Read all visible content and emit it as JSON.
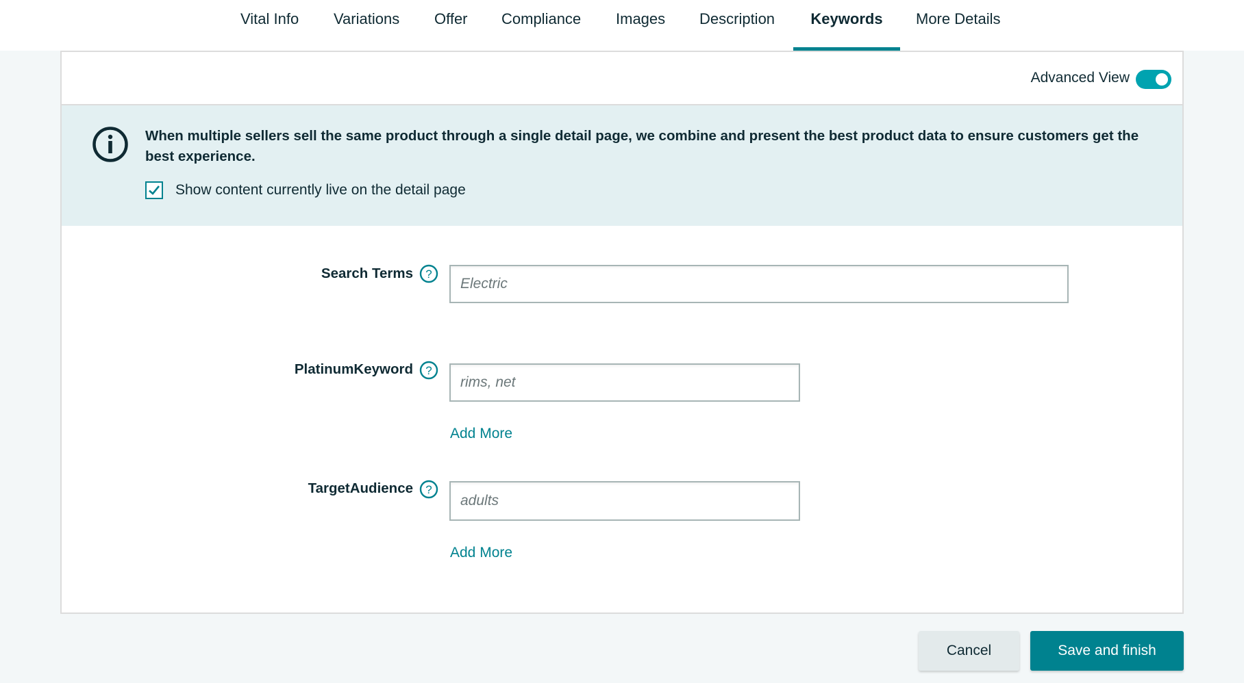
{
  "tabs": [
    {
      "label": "Vital Info",
      "active": false
    },
    {
      "label": "Variations",
      "active": false
    },
    {
      "label": "Offer",
      "active": false
    },
    {
      "label": "Compliance",
      "active": false
    },
    {
      "label": "Images",
      "active": false
    },
    {
      "label": "Description",
      "active": false
    },
    {
      "label": "Keywords",
      "active": true
    },
    {
      "label": "More Details",
      "active": false
    }
  ],
  "advanced_view": {
    "label": "Advanced View",
    "enabled": true
  },
  "banner": {
    "icon": "info-icon",
    "message": "When multiple sellers sell the same product through a single detail page, we combine and present the best product data to ensure customers get the best experience.",
    "checkbox": {
      "label": "Show content currently live on the detail page",
      "checked": true
    }
  },
  "fields": [
    {
      "label": "Search Terms",
      "help_icon": "question-circle-icon",
      "placeholder": "Electric",
      "value": "",
      "add_more": null
    },
    {
      "label": "PlatinumKeyword",
      "help_icon": "question-circle-icon",
      "placeholder": "rims, net",
      "value": "",
      "add_more": "Add More"
    },
    {
      "label": "TargetAudience",
      "help_icon": "question-circle-icon",
      "placeholder": "adults",
      "value": "",
      "add_more": "Add More"
    }
  ],
  "actions": {
    "cancel_label": "Cancel",
    "save_label": "Save and finish"
  },
  "colors": {
    "accent": "#00828f",
    "toggle": "#00a3b0",
    "banner_bg": "#e3f0f2",
    "text": "#0f2a33"
  }
}
